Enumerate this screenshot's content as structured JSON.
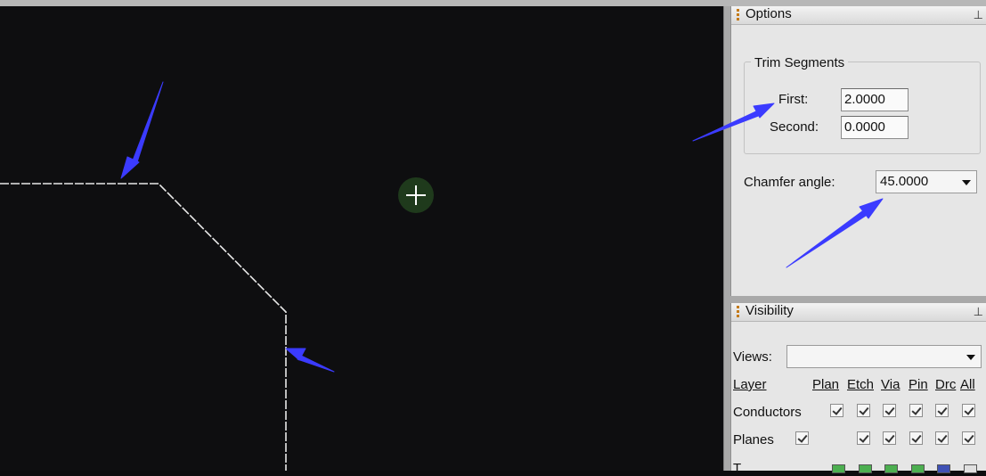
{
  "options_panel": {
    "title": "Options",
    "trim_segments": {
      "title": "Trim Segments",
      "first_label": "First:",
      "first_value": "2.0000",
      "second_label": "Second:",
      "second_value": "0.0000"
    },
    "chamfer_label": "Chamfer angle:",
    "chamfer_value": "45.0000"
  },
  "visibility_panel": {
    "title": "Visibility",
    "views_label": "Views:",
    "views_value": "",
    "columns": [
      "Layer",
      "Plan",
      "Etch",
      "Via",
      "Pin",
      "Drc",
      "All"
    ],
    "rows": [
      {
        "label": "Conductors",
        "checks": [
          true,
          true,
          true,
          true,
          true,
          true
        ]
      },
      {
        "label": "Planes",
        "checks": [
          true,
          true,
          true,
          true,
          true,
          true
        ]
      }
    ],
    "partial_row_label": "T"
  },
  "colors": {
    "canvas": "#0e0e10",
    "annotation_arrow": "#3b3bff",
    "outline": "#e8e8e8",
    "cursor_bg": "#1f3a1c"
  },
  "icons": {
    "cursor": "crosshair-icon",
    "pin": "pin-icon",
    "dropdown": "chevron-down-icon"
  }
}
